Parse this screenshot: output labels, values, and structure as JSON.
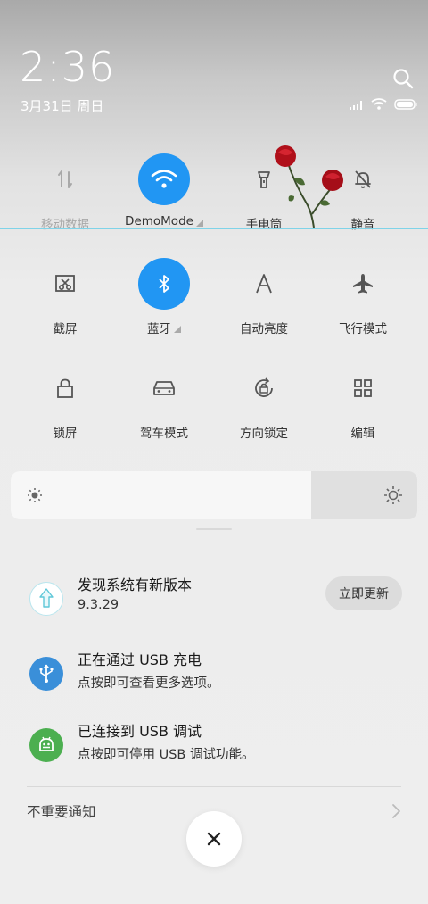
{
  "header": {
    "time": "2:36",
    "date": "3月31日 周日"
  },
  "tiles": [
    {
      "label": "移动数据",
      "icon": "mobile-data-icon",
      "active": false,
      "dimmed": true
    },
    {
      "label": "DemoMode",
      "icon": "wifi-icon",
      "active": true,
      "dimmed": false,
      "expand": true
    },
    {
      "label": "手电筒",
      "icon": "flashlight-icon",
      "active": false,
      "dimmed": false
    },
    {
      "label": "静音",
      "icon": "mute-bell-icon",
      "active": false,
      "dimmed": false
    },
    {
      "label": "截屏",
      "icon": "screenshot-icon",
      "active": false,
      "dimmed": false
    },
    {
      "label": "蓝牙",
      "icon": "bluetooth-icon",
      "active": true,
      "dimmed": false,
      "expand": true
    },
    {
      "label": "自动亮度",
      "icon": "auto-brightness-icon",
      "active": false,
      "dimmed": false
    },
    {
      "label": "飞行模式",
      "icon": "airplane-icon",
      "active": false,
      "dimmed": false
    },
    {
      "label": "锁屏",
      "icon": "lock-icon",
      "active": false,
      "dimmed": false
    },
    {
      "label": "驾车模式",
      "icon": "car-icon",
      "active": false,
      "dimmed": false
    },
    {
      "label": "方向锁定",
      "icon": "rotation-lock-icon",
      "active": false,
      "dimmed": false
    },
    {
      "label": "编辑",
      "icon": "grid-edit-icon",
      "active": false,
      "dimmed": false
    }
  ],
  "brightness": {
    "level": 0.74
  },
  "notifications": [
    {
      "title": "发现系统有新版本",
      "subtitle": "9.3.29",
      "icon": "update-arrow-icon",
      "action": "立即更新"
    },
    {
      "title": "正在通过  USB  充电",
      "subtitle": "点按即可查看更多选项。",
      "icon": "usb-icon"
    },
    {
      "title": "已连接到  USB  调试",
      "subtitle": "点按即可停用 USB 调试功能。",
      "icon": "android-icon"
    }
  ],
  "footer": {
    "unimportant_label": "不重要通知"
  },
  "colors": {
    "accent": "#2196f3",
    "usb_icon_bg": "#3a8fd9",
    "android_icon_bg": "#4caf50"
  }
}
